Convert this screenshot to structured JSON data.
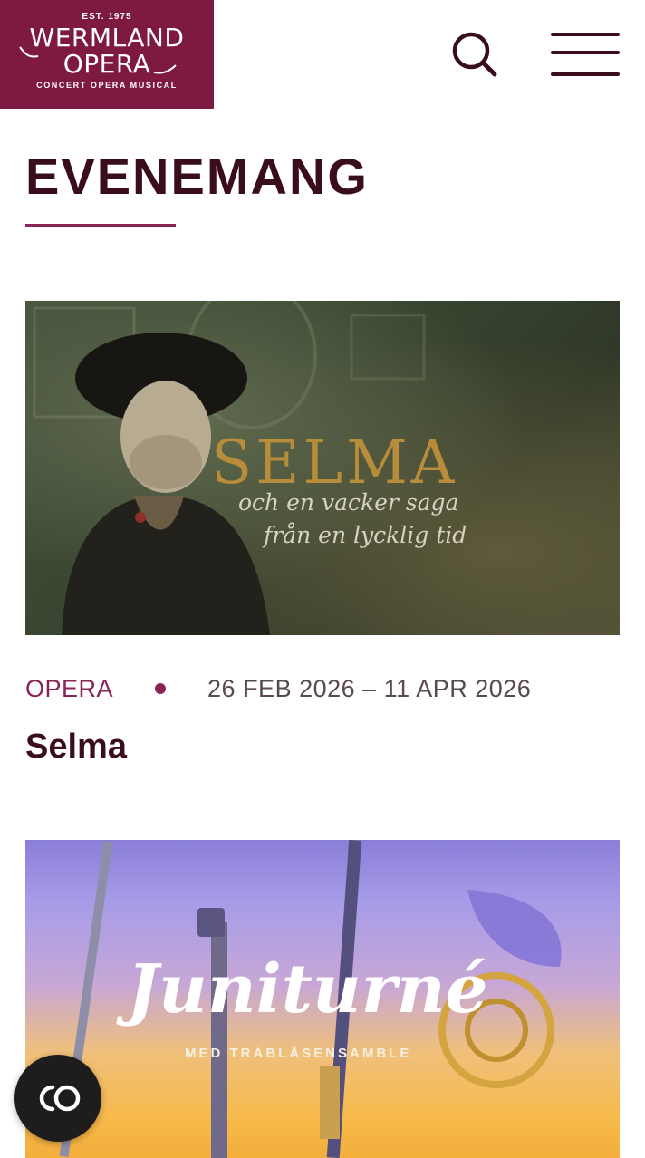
{
  "logo": {
    "est": "EST. 1975",
    "line1": "WERMLAND",
    "line2": "OPERA",
    "tagline": "CONCERT  OPERA  MUSICAL",
    "bg_color": "#7e1941"
  },
  "header": {
    "search_icon": "search-icon",
    "menu_icon": "hamburger-menu-icon"
  },
  "page": {
    "title": "EVENEMANG"
  },
  "events": [
    {
      "category": "OPERA",
      "dates": "26 FEB 2026 – 11 APR 2026",
      "title": "Selma",
      "image_text": {
        "headline": "SELMA",
        "tagline_1": "och en vacker saga",
        "tagline_2": "från en lycklig tid"
      }
    },
    {
      "image_text": {
        "headline": "Juniturné",
        "subline": "MED TRÄBLÅSENSAMBLE"
      }
    }
  ],
  "floating_button": {
    "icon": "cookie-consent-icon",
    "label": "CO"
  },
  "colors": {
    "accent": "#8a2457",
    "text_dark": "#3a0d1e",
    "date_gray": "#5a4950"
  }
}
